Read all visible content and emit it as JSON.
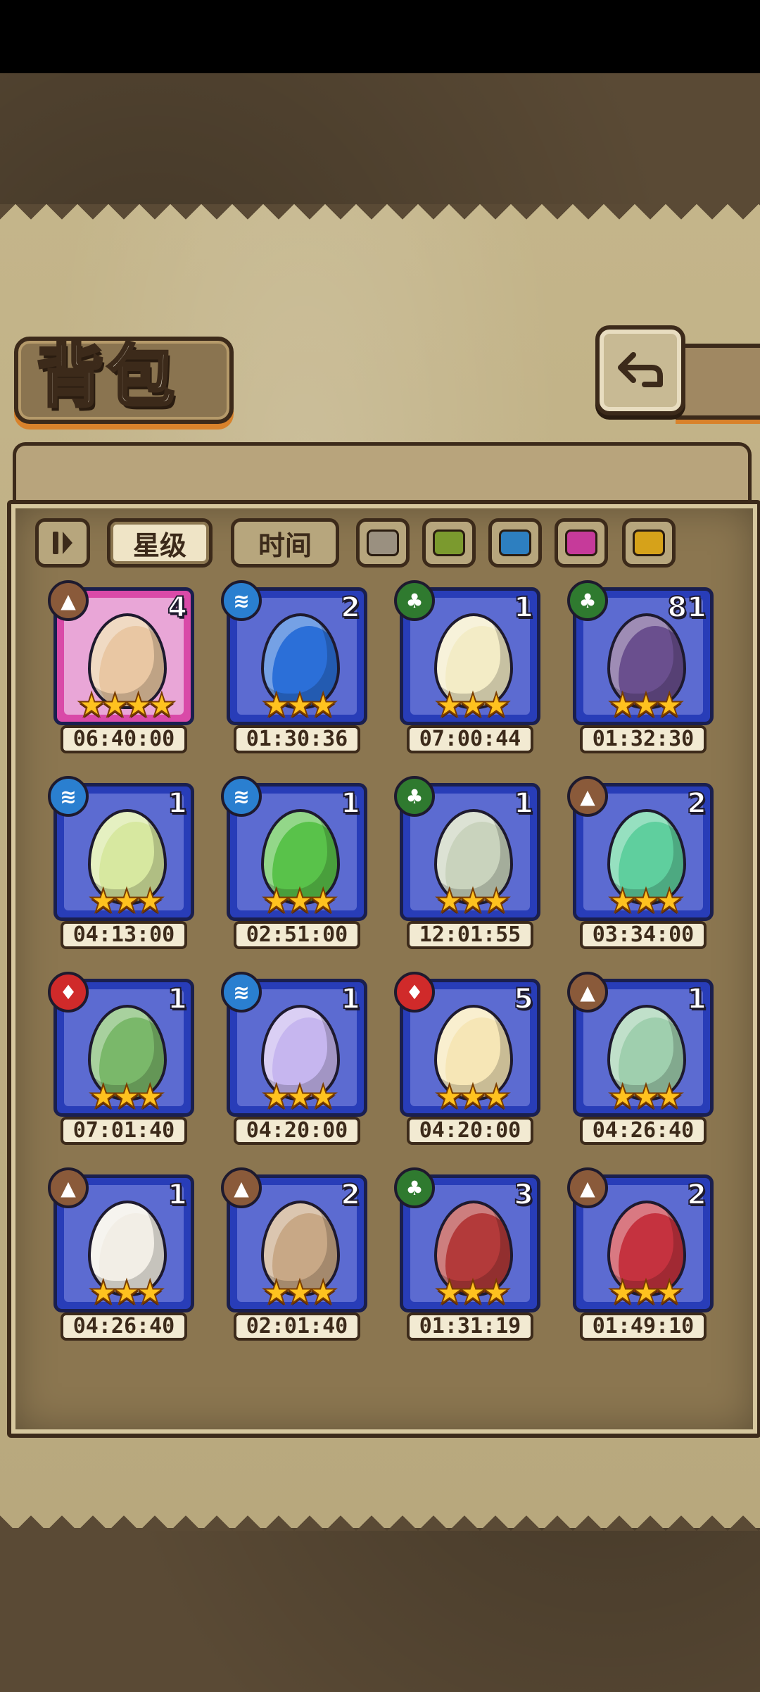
{
  "title": "背包",
  "filters": {
    "sort_star": "星级",
    "sort_time": "时间",
    "rarity_colors": [
      {
        "name": "gray",
        "color": "#9a9080"
      },
      {
        "name": "green",
        "color": "#7b9a2e"
      },
      {
        "name": "blue",
        "color": "#2d7fc0"
      },
      {
        "name": "pink",
        "color": "#c63a9a"
      },
      {
        "name": "gold",
        "color": "#d6a21a"
      }
    ]
  },
  "colors": {
    "earth": "#8a5a3a",
    "water": "#2a7fd0",
    "grass": "#2f7a2f",
    "fire": "#d02a2a"
  },
  "eggs": [
    {
      "element": "earth",
      "count": "4",
      "stars": "★★★★",
      "timer": "06:40:00",
      "rarity": "pink",
      "egg_color": "#e9c7a3"
    },
    {
      "element": "water",
      "count": "2",
      "stars": "★★★",
      "timer": "01:30:36",
      "rarity": "blue",
      "egg_color": "#2b6fd8"
    },
    {
      "element": "grass",
      "count": "1",
      "stars": "★★★",
      "timer": "07:00:44",
      "rarity": "blue",
      "egg_color": "#f3ecc6"
    },
    {
      "element": "grass",
      "count": "81",
      "stars": "★★★",
      "timer": "01:32:30",
      "rarity": "blue",
      "egg_color": "#6a4f8e"
    },
    {
      "element": "water",
      "count": "1",
      "stars": "★★★",
      "timer": "04:13:00",
      "rarity": "blue",
      "egg_color": "#d7e8a0"
    },
    {
      "element": "water",
      "count": "1",
      "stars": "★★★",
      "timer": "02:51:00",
      "rarity": "blue",
      "egg_color": "#59c24a"
    },
    {
      "element": "grass",
      "count": "1",
      "stars": "★★★",
      "timer": "12:01:55",
      "rarity": "blue",
      "egg_color": "#c9d3bd"
    },
    {
      "element": "earth",
      "count": "2",
      "stars": "★★★",
      "timer": "03:34:00",
      "rarity": "blue",
      "egg_color": "#5fcf9e"
    },
    {
      "element": "fire",
      "count": "1",
      "stars": "★★★",
      "timer": "07:01:40",
      "rarity": "blue",
      "egg_color": "#7ab86a"
    },
    {
      "element": "water",
      "count": "1",
      "stars": "★★★",
      "timer": "04:20:00",
      "rarity": "blue",
      "egg_color": "#c6b6ef"
    },
    {
      "element": "fire",
      "count": "5",
      "stars": "★★★",
      "timer": "04:20:00",
      "rarity": "blue",
      "egg_color": "#f6e6b6"
    },
    {
      "element": "earth",
      "count": "1",
      "stars": "★★★",
      "timer": "04:26:40",
      "rarity": "blue",
      "egg_color": "#9fcfae"
    },
    {
      "element": "earth",
      "count": "1",
      "stars": "★★★",
      "timer": "04:26:40",
      "rarity": "blue",
      "egg_color": "#f2eee6"
    },
    {
      "element": "earth",
      "count": "2",
      "stars": "★★★",
      "timer": "02:01:40",
      "rarity": "blue",
      "egg_color": "#c8a886"
    },
    {
      "element": "grass",
      "count": "3",
      "stars": "★★★",
      "timer": "01:31:19",
      "rarity": "blue",
      "egg_color": "#b33a3a"
    },
    {
      "element": "earth",
      "count": "2",
      "stars": "★★★",
      "timer": "01:49:10",
      "rarity": "blue",
      "egg_color": "#c5323f"
    }
  ]
}
